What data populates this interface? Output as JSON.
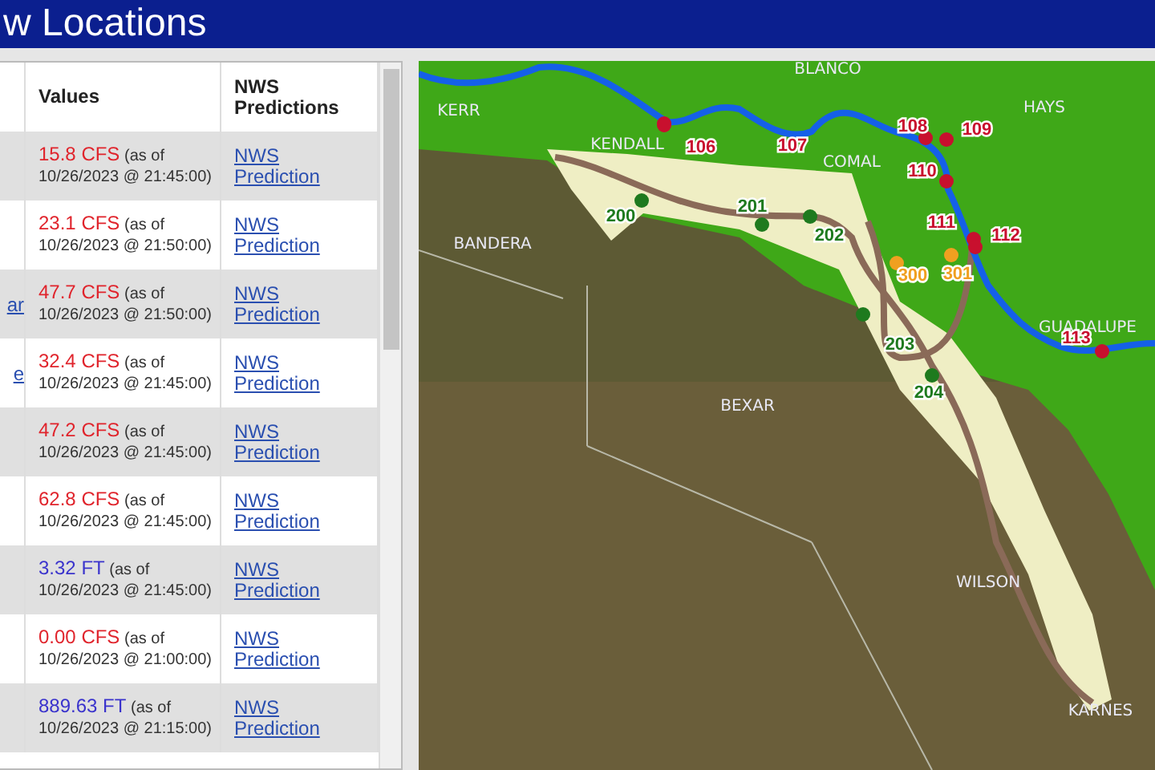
{
  "header": {
    "title": "w Locations"
  },
  "table": {
    "columns": [
      "Values",
      "NWS Predictions"
    ],
    "rows": [
      {
        "column_1": "",
        "value": "15.8 CFS",
        "color": "#e0242c",
        "timestamp": "(as of 10/26/2023 @ 21:45:00)",
        "link": "NWS Prediction",
        "shaded": true
      },
      {
        "column_1": "",
        "value": "23.1 CFS",
        "color": "#e0242c",
        "timestamp": "(as of 10/26/2023 @ 21:50:00)",
        "link": "NWS Prediction",
        "shaded": false
      },
      {
        "column_1": "ar",
        "value": "47.7 CFS",
        "color": "#e0242c",
        "timestamp": "(as of 10/26/2023 @ 21:50:00)",
        "link": "NWS Prediction",
        "shaded": true
      },
      {
        "column_1": "e",
        "value": "32.4 CFS",
        "color": "#e0242c",
        "timestamp": "(as of 10/26/2023 @ 21:45:00)",
        "link": "NWS Prediction",
        "shaded": false
      },
      {
        "column_1": "",
        "value": "47.2 CFS",
        "color": "#e0242c",
        "timestamp": "(as of 10/26/2023 @ 21:45:00)",
        "link": "NWS Prediction",
        "shaded": true
      },
      {
        "column_1": "",
        "value": "62.8 CFS",
        "color": "#e0242c",
        "timestamp": "(as of 10/26/2023 @ 21:45:00)",
        "link": "NWS Prediction",
        "shaded": false
      },
      {
        "column_1": "",
        "value": "3.32 FT",
        "color": "#3a33cc",
        "timestamp": "(as of 10/26/2023 @ 21:45:00)",
        "link": "NWS Prediction",
        "shaded": true
      },
      {
        "column_1": "",
        "value": "0.00 CFS",
        "color": "#e0242c",
        "timestamp": "(as of 10/26/2023 @ 21:00:00)",
        "link": "NWS Prediction",
        "shaded": false
      },
      {
        "column_1": "",
        "value": "889.63 FT",
        "color": "#3a33cc",
        "timestamp": "(as of 10/26/2023 @ 21:15:00)",
        "link": "NWS Prediction",
        "shaded": true
      }
    ]
  },
  "map": {
    "counties": [
      "BLANCO",
      "KERR",
      "HAYS",
      "KENDALL",
      "COMAL",
      "BANDERA",
      "GUADALUPE",
      "BEXAR",
      "WILSON",
      "KARNES"
    ],
    "sites": [
      {
        "label": "106",
        "color": "#c8102e"
      },
      {
        "label": "107",
        "color": "#c8102e"
      },
      {
        "label": "108",
        "color": "#c8102e"
      },
      {
        "label": "109",
        "color": "#c8102e"
      },
      {
        "label": "110",
        "color": "#c8102e"
      },
      {
        "label": "111",
        "color": "#c8102e"
      },
      {
        "label": "112",
        "color": "#c8102e"
      },
      {
        "label": "113",
        "color": "#c8102e"
      },
      {
        "label": "200",
        "color": "#1e7a1e"
      },
      {
        "label": "201",
        "color": "#1e7a1e"
      },
      {
        "label": "202",
        "color": "#1e7a1e"
      },
      {
        "label": "203",
        "color": "#1e7a1e"
      },
      {
        "label": "204",
        "color": "#1e7a1e"
      },
      {
        "label": "300",
        "color": "#f0a020"
      },
      {
        "label": "301",
        "color": "#f0a020"
      }
    ]
  }
}
